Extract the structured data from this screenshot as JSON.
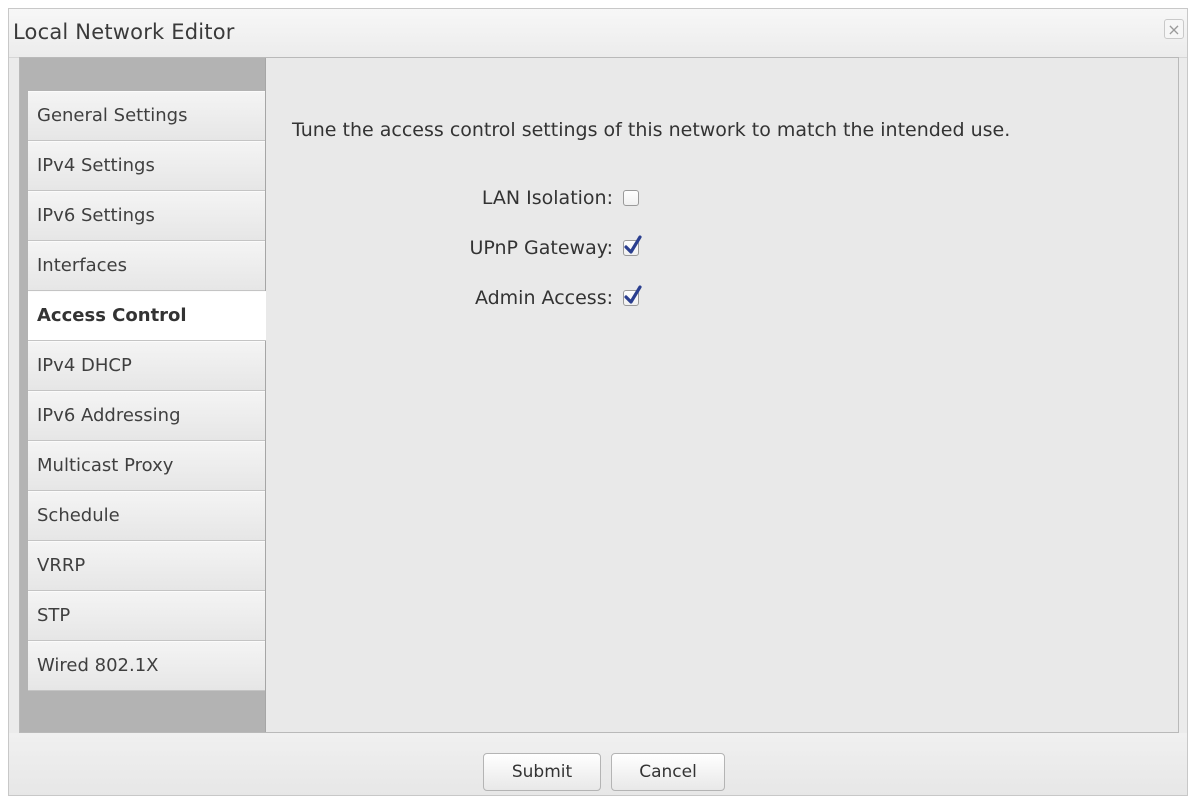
{
  "dialog": {
    "title": "Local Network Editor",
    "close_label": "×"
  },
  "sidebar": {
    "items": [
      {
        "label": "General Settings",
        "active": false
      },
      {
        "label": "IPv4 Settings",
        "active": false
      },
      {
        "label": "IPv6 Settings",
        "active": false
      },
      {
        "label": "Interfaces",
        "active": false
      },
      {
        "label": "Access Control",
        "active": true
      },
      {
        "label": "IPv4 DHCP",
        "active": false
      },
      {
        "label": "IPv6 Addressing",
        "active": false
      },
      {
        "label": "Multicast Proxy",
        "active": false
      },
      {
        "label": "Schedule",
        "active": false
      },
      {
        "label": "VRRP",
        "active": false
      },
      {
        "label": "STP",
        "active": false
      },
      {
        "label": "Wired 802.1X",
        "active": false
      }
    ]
  },
  "main": {
    "description": "Tune the access control settings of this network to match the intended use.",
    "fields": [
      {
        "label": "LAN Isolation:",
        "checked": false
      },
      {
        "label": "UPnP Gateway:",
        "checked": true
      },
      {
        "label": "Admin Access:",
        "checked": true
      }
    ]
  },
  "footer": {
    "submit_label": "Submit",
    "cancel_label": "Cancel"
  },
  "colors": {
    "check_mark": "#2b3f8f",
    "sidebar_bg": "#b3b3b3",
    "content_bg": "#e9e9e9"
  }
}
